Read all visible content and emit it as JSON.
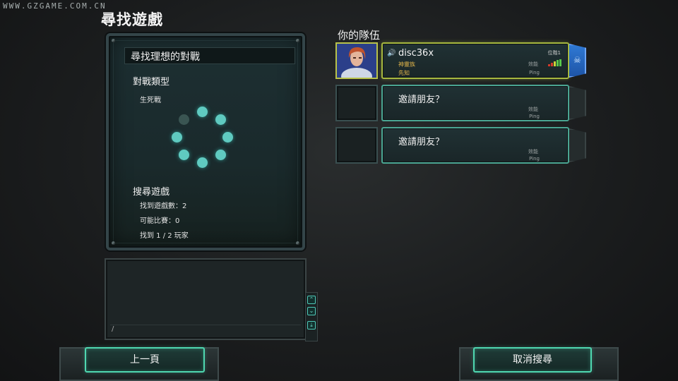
{
  "watermark": "WWW.GZGAME.COM.CN",
  "page_title": "尋找遊戲",
  "match_panel": {
    "header": "尋找理想的對戰",
    "match_type_label": "對戰類型",
    "match_type_value": "生死戰",
    "search_label": "搜尋遊戲",
    "games_found": "找到遊戲數：2",
    "possible_matches": "可能比賽：0",
    "players_found": "找到 1 / 2 玩家"
  },
  "chat": {
    "input_cursor": "/",
    "scroll_up": "⌃",
    "scroll_down": "⌄",
    "scroll_end": "⤓"
  },
  "team": {
    "title": "你的隊伍",
    "slots": [
      {
        "name": "disc36x",
        "race": "神靈族",
        "rank": "先知",
        "position": "位階1",
        "efficiency": "效能",
        "ping": "Ping",
        "active": true
      },
      {
        "invite": "邀請朋友？",
        "efficiency": "效能",
        "ping": "Ping"
      },
      {
        "invite": "邀請朋友？",
        "efficiency": "效能",
        "ping": "Ping"
      }
    ]
  },
  "buttons": {
    "back": "上一頁",
    "cancel_search": "取消搜尋"
  },
  "colors": {
    "accent_teal": "#4fd7b0",
    "active_yellow": "#a6b840",
    "team_blue": "#2f79d4"
  },
  "icons": [
    "speaker-icon",
    "skull-icon",
    "ping-bars-icon"
  ]
}
